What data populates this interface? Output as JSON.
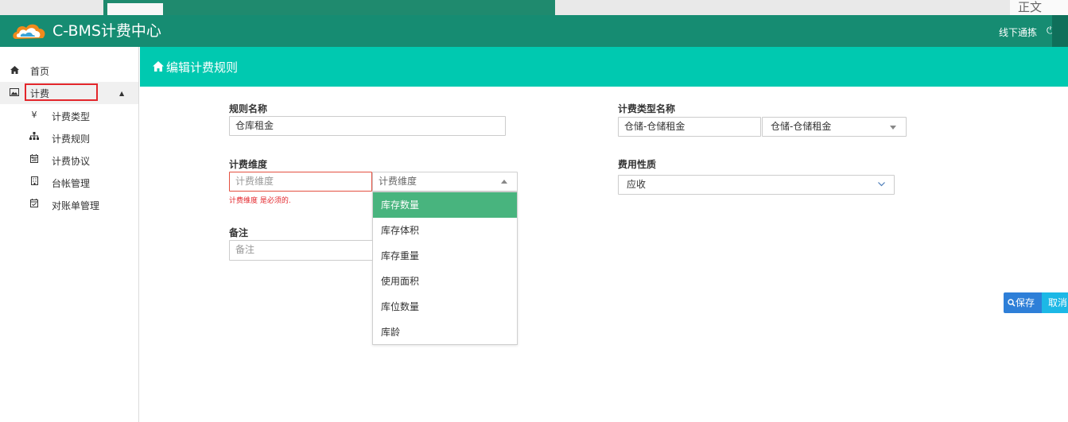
{
  "background": {
    "text_right": "正文"
  },
  "header": {
    "brand": "C-BMS计费中心",
    "user": "线下通拣",
    "colors": {
      "header": "#168c72",
      "banner": "#00c9b0"
    }
  },
  "sidebar": {
    "items": [
      {
        "label": "首页",
        "icon": "home-icon"
      },
      {
        "label": "计费",
        "icon": "image-icon"
      }
    ],
    "sub_items": [
      {
        "label": "计费类型",
        "icon": "yen-icon",
        "glyph": "¥"
      },
      {
        "label": "计费规则",
        "icon": "sitemap-icon"
      },
      {
        "label": "计费协议",
        "icon": "calendar-icon"
      },
      {
        "label": "台帐管理",
        "icon": "building-icon"
      },
      {
        "label": "对账单管理",
        "icon": "calendar-check-icon"
      }
    ]
  },
  "page": {
    "title": "编辑计费规则"
  },
  "form": {
    "rule_name": {
      "label": "规则名称",
      "value": "仓库租金"
    },
    "billing_type_name": {
      "label": "计费类型名称",
      "value": "仓储-仓储租金",
      "selected": "仓储-仓储租金"
    },
    "dimension": {
      "label": "计费维度",
      "placeholder": "计费维度",
      "error": "计费维度 是必须的.",
      "select_placeholder": "计费维度"
    },
    "fee_nature": {
      "label": "费用性质",
      "value": "应收"
    },
    "remark": {
      "label": "备注",
      "placeholder": "备注"
    }
  },
  "dropdown": {
    "options": [
      "库存数量",
      "库存体积",
      "库存重量",
      "使用面积",
      "库位数量",
      "库龄"
    ],
    "selected_index": 0
  },
  "buttons": {
    "save": "保存",
    "cancel": "取消"
  }
}
